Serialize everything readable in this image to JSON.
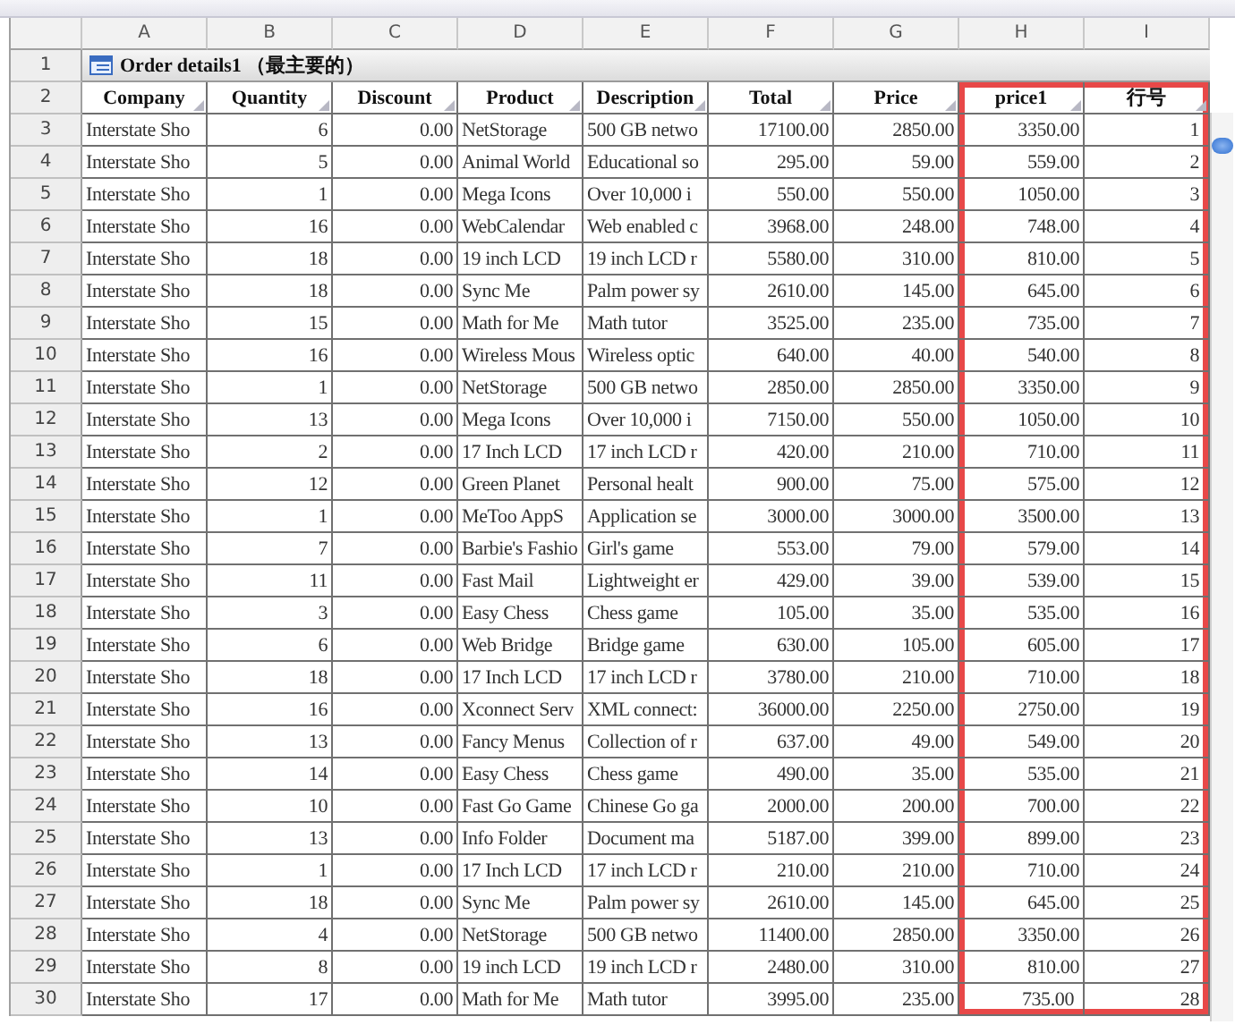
{
  "column_letters": [
    "A",
    "B",
    "C",
    "D",
    "E",
    "F",
    "G",
    "H",
    "I"
  ],
  "title": "Order details1 （最主要的）",
  "headers": [
    {
      "label": "Company",
      "highlighted": false
    },
    {
      "label": "Quantity",
      "highlighted": false
    },
    {
      "label": "Discount",
      "highlighted": false
    },
    {
      "label": "Product",
      "highlighted": false
    },
    {
      "label": "Description",
      "highlighted": false
    },
    {
      "label": "Total",
      "highlighted": false
    },
    {
      "label": "Price",
      "highlighted": false
    },
    {
      "label": "price1",
      "highlighted": true
    },
    {
      "label": "行号",
      "highlighted": true
    }
  ],
  "row_numbers": [
    "1",
    "2"
  ],
  "rows": [
    [
      "3",
      "Interstate Sho",
      "6",
      "0.00",
      "NetStorage",
      "500 GB netwo",
      "17100.00",
      "2850.00",
      "3350.00",
      "1"
    ],
    [
      "4",
      "Interstate Sho",
      "5",
      "0.00",
      "Animal World",
      "Educational so",
      "295.00",
      "59.00",
      "559.00",
      "2"
    ],
    [
      "5",
      "Interstate Sho",
      "1",
      "0.00",
      "Mega Icons",
      "Over 10,000 i",
      "550.00",
      "550.00",
      "1050.00",
      "3"
    ],
    [
      "6",
      "Interstate Sho",
      "16",
      "0.00",
      "WebCalendar",
      "Web enabled c",
      "3968.00",
      "248.00",
      "748.00",
      "4"
    ],
    [
      "7",
      "Interstate Sho",
      "18",
      "0.00",
      "19 inch LCD",
      "19 inch LCD r",
      "5580.00",
      "310.00",
      "810.00",
      "5"
    ],
    [
      "8",
      "Interstate Sho",
      "18",
      "0.00",
      "Sync Me",
      "Palm power sy",
      "2610.00",
      "145.00",
      "645.00",
      "6"
    ],
    [
      "9",
      "Interstate Sho",
      "15",
      "0.00",
      "Math for Me",
      "Math tutor",
      "3525.00",
      "235.00",
      "735.00",
      "7"
    ],
    [
      "10",
      "Interstate Sho",
      "16",
      "0.00",
      "Wireless Mous",
      "Wireless optic",
      "640.00",
      "40.00",
      "540.00",
      "8"
    ],
    [
      "11",
      "Interstate Sho",
      "1",
      "0.00",
      "NetStorage",
      "500 GB netwo",
      "2850.00",
      "2850.00",
      "3350.00",
      "9"
    ],
    [
      "12",
      "Interstate Sho",
      "13",
      "0.00",
      "Mega Icons",
      "Over 10,000 i",
      "7150.00",
      "550.00",
      "1050.00",
      "10"
    ],
    [
      "13",
      "Interstate Sho",
      "2",
      "0.00",
      "17 Inch LCD",
      "17 inch LCD r",
      "420.00",
      "210.00",
      "710.00",
      "11"
    ],
    [
      "14",
      "Interstate Sho",
      "12",
      "0.00",
      "Green Planet",
      "Personal healt",
      "900.00",
      "75.00",
      "575.00",
      "12"
    ],
    [
      "15",
      "Interstate Sho",
      "1",
      "0.00",
      "MeToo AppS",
      "Application se",
      "3000.00",
      "3000.00",
      "3500.00",
      "13"
    ],
    [
      "16",
      "Interstate Sho",
      "7",
      "0.00",
      "Barbie's Fashio",
      "Girl's game",
      "553.00",
      "79.00",
      "579.00",
      "14"
    ],
    [
      "17",
      "Interstate Sho",
      "11",
      "0.00",
      "Fast Mail",
      "Lightweight er",
      "429.00",
      "39.00",
      "539.00",
      "15"
    ],
    [
      "18",
      "Interstate Sho",
      "3",
      "0.00",
      "Easy Chess",
      "Chess game",
      "105.00",
      "35.00",
      "535.00",
      "16"
    ],
    [
      "19",
      "Interstate Sho",
      "6",
      "0.00",
      "Web Bridge",
      "Bridge game",
      "630.00",
      "105.00",
      "605.00",
      "17"
    ],
    [
      "20",
      "Interstate Sho",
      "18",
      "0.00",
      "17 Inch LCD",
      "17 inch LCD r",
      "3780.00",
      "210.00",
      "710.00",
      "18"
    ],
    [
      "21",
      "Interstate Sho",
      "16",
      "0.00",
      "Xconnect Serv",
      "XML connect:",
      "36000.00",
      "2250.00",
      "2750.00",
      "19"
    ],
    [
      "22",
      "Interstate Sho",
      "13",
      "0.00",
      "Fancy Menus",
      "Collection of r",
      "637.00",
      "49.00",
      "549.00",
      "20"
    ],
    [
      "23",
      "Interstate Sho",
      "14",
      "0.00",
      "Easy Chess",
      "Chess game",
      "490.00",
      "35.00",
      "535.00",
      "21"
    ],
    [
      "24",
      "Interstate Sho",
      "10",
      "0.00",
      "Fast Go Game",
      "Chinese Go ga",
      "2000.00",
      "200.00",
      "700.00",
      "22"
    ],
    [
      "25",
      "Interstate Sho",
      "13",
      "0.00",
      "Info Folder",
      "Document ma",
      "5187.00",
      "399.00",
      "899.00",
      "23"
    ],
    [
      "26",
      "Interstate Sho",
      "1",
      "0.00",
      "17 Inch LCD",
      "17 inch LCD r",
      "210.00",
      "210.00",
      "710.00",
      "24"
    ],
    [
      "27",
      "Interstate Sho",
      "18",
      "0.00",
      "Sync Me",
      "Palm power sy",
      "2610.00",
      "145.00",
      "645.00",
      "25"
    ],
    [
      "28",
      "Interstate Sho",
      "4",
      "0.00",
      "NetStorage",
      "500 GB netwo",
      "11400.00",
      "2850.00",
      "3350.00",
      "26"
    ],
    [
      "29",
      "Interstate Sho",
      "8",
      "0.00",
      "19 inch LCD",
      "19 inch LCD r",
      "2480.00",
      "310.00",
      "810.00",
      "27"
    ],
    [
      "30",
      "Interstate Sho",
      "17",
      "0.00",
      "Math for Me",
      "Math tutor",
      "3995.00",
      "235.00",
      "735.00",
      "28"
    ]
  ]
}
